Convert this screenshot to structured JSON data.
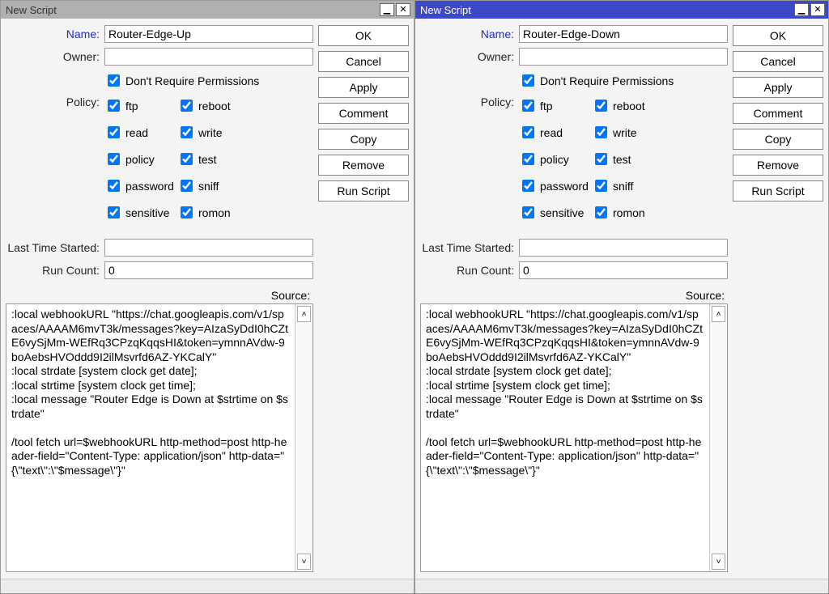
{
  "dialogs": [
    {
      "active": false,
      "title": "New Script",
      "fields": {
        "name_label": "Name:",
        "name_value": "Router-Edge-Up",
        "owner_label": "Owner:",
        "owner_value": "",
        "dont_require_perm": "Don't Require Permissions",
        "policy_label": "Policy:",
        "last_time_label": "Last Time Started:",
        "last_time_value": "",
        "run_count_label": "Run Count:",
        "run_count_value": "0",
        "source_label": "Source:"
      },
      "policies": {
        "ftp": "ftp",
        "reboot": "reboot",
        "read": "read",
        "write": "write",
        "policy": "policy",
        "test": "test",
        "password": "password",
        "sniff": "sniff",
        "sensitive": "sensitive",
        "romon": "romon"
      },
      "source": ":local webhookURL \"https://chat.googleapis.com/v1/spaces/AAAAM6mvT3k/messages?key=AIzaSyDdI0hCZtE6vySjMm-WEfRq3CPzqKqqsHI&token=ymnnAVdw-9boAebsHVOddd9I2ilMsvrfd6AZ-YKCalY\"\n:local strdate [system clock get date];\n:local strtime [system clock get time];\n:local message \"Router Edge is Down at $strtime on $strdate\"\n\n/tool fetch url=$webhookURL http-method=post http-header-field=\"Content-Type: application/json\" http-data=\"{\\\"text\\\":\\\"$message\\\"}\"",
      "buttons": {
        "ok": "OK",
        "cancel": "Cancel",
        "apply": "Apply",
        "comment": "Comment",
        "copy": "Copy",
        "remove": "Remove",
        "run": "Run Script"
      }
    },
    {
      "active": true,
      "title": "New Script",
      "fields": {
        "name_label": "Name:",
        "name_value": "Router-Edge-Down",
        "owner_label": "Owner:",
        "owner_value": "",
        "dont_require_perm": "Don't Require Permissions",
        "policy_label": "Policy:",
        "last_time_label": "Last Time Started:",
        "last_time_value": "",
        "run_count_label": "Run Count:",
        "run_count_value": "0",
        "source_label": "Source:"
      },
      "policies": {
        "ftp": "ftp",
        "reboot": "reboot",
        "read": "read",
        "write": "write",
        "policy": "policy",
        "test": "test",
        "password": "password",
        "sniff": "sniff",
        "sensitive": "sensitive",
        "romon": "romon"
      },
      "source": ":local webhookURL \"https://chat.googleapis.com/v1/spaces/AAAAM6mvT3k/messages?key=AIzaSyDdI0hCZtE6vySjMm-WEfRq3CPzqKqqsHI&token=ymnnAVdw-9boAebsHVOddd9I2ilMsvrfd6AZ-YKCalY\"\n:local strdate [system clock get date];\n:local strtime [system clock get time];\n:local message \"Router Edge is Down at $strtime on $strdate\"\n\n/tool fetch url=$webhookURL http-method=post http-header-field=\"Content-Type: application/json\" http-data=\"{\\\"text\\\":\\\"$message\\\"}\"",
      "buttons": {
        "ok": "OK",
        "cancel": "Cancel",
        "apply": "Apply",
        "comment": "Comment",
        "copy": "Copy",
        "remove": "Remove",
        "run": "Run Script"
      }
    }
  ]
}
